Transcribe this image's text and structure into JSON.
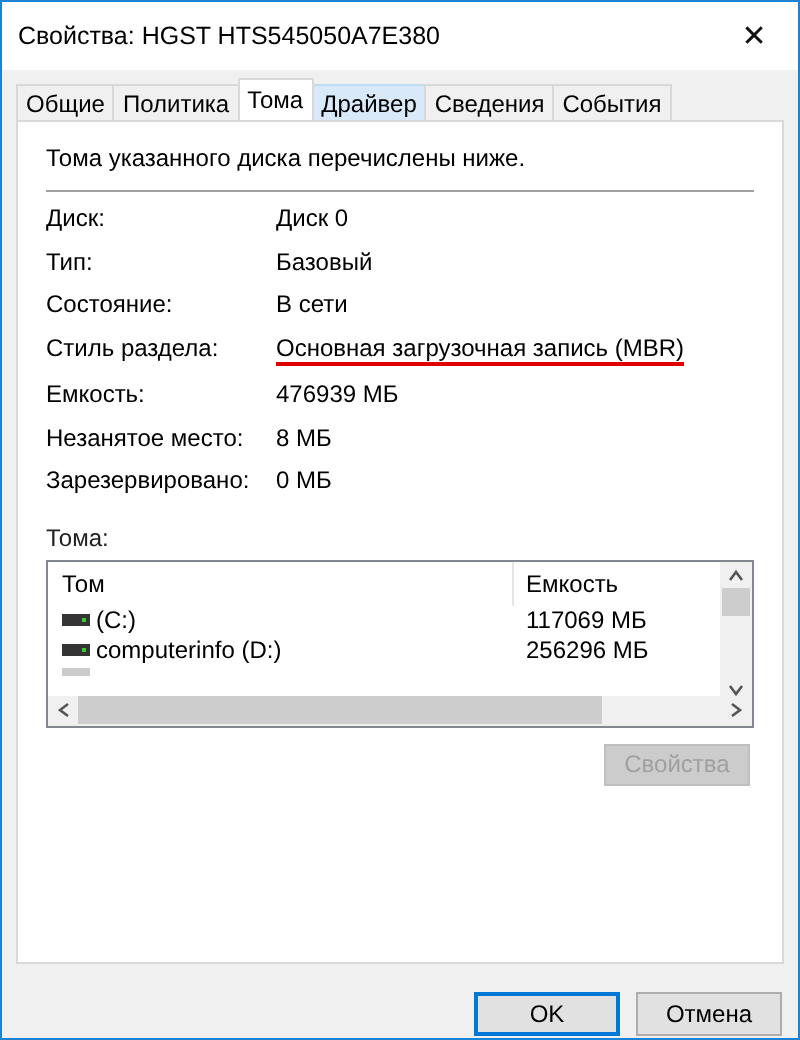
{
  "window": {
    "title": "Свойства: HGST HTS545050A7E380",
    "close": "✕"
  },
  "tabs": [
    {
      "label": "Общие",
      "selected": false,
      "hovered": false
    },
    {
      "label": "Политика",
      "selected": false,
      "hovered": false
    },
    {
      "label": "Тома",
      "selected": true,
      "hovered": false
    },
    {
      "label": "Драйвер",
      "selected": false,
      "hovered": true
    },
    {
      "label": "Сведения",
      "selected": false,
      "hovered": false
    },
    {
      "label": "События",
      "selected": false,
      "hovered": false
    }
  ],
  "intro": "Тома указанного диска перечислены ниже.",
  "properties": [
    {
      "label": "Диск:",
      "value": "Диск 0",
      "underlined": false
    },
    {
      "label": "Тип:",
      "value": "Базовый",
      "underlined": false
    },
    {
      "label": "Состояние:",
      "value": "В сети",
      "underlined": false
    },
    {
      "label": "Стиль раздела:",
      "value": "Основная загрузочная запись (MBR)",
      "underlined": true
    },
    {
      "label": "Емкость:",
      "value": "476939 МБ",
      "underlined": false
    },
    {
      "label": "Незанятое место:",
      "value": "8 МБ",
      "underlined": false
    },
    {
      "label": "Зарезервировано:",
      "value": "0 МБ",
      "underlined": false
    }
  ],
  "volumes_label": "Тома:",
  "table": {
    "columns": [
      "Том",
      "Емкость"
    ],
    "rows": [
      {
        "name": "(C:)",
        "capacity": "117069 МБ"
      },
      {
        "name": "computerinfo (D:)",
        "capacity": "256296 МБ"
      }
    ]
  },
  "properties_button": {
    "label": "Свойства",
    "disabled": true
  },
  "buttons": [
    {
      "label": "OK",
      "default": true
    },
    {
      "label": "Отмена",
      "default": false
    }
  ]
}
